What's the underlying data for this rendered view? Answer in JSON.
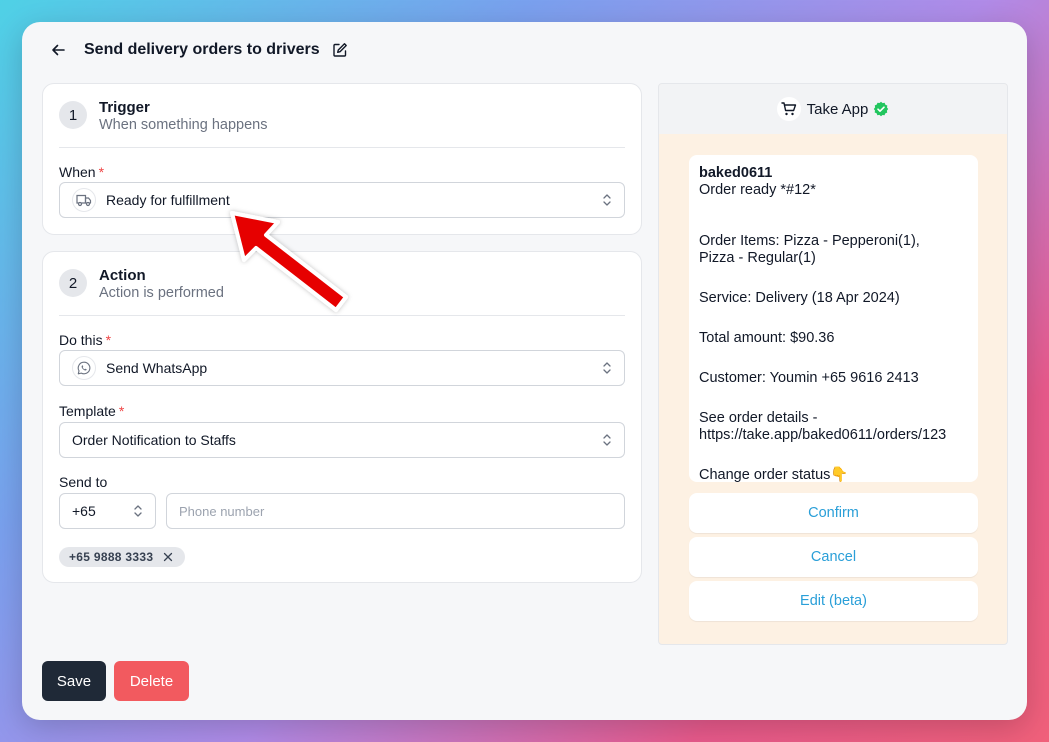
{
  "header": {
    "title": "Send delivery orders to drivers"
  },
  "trigger": {
    "number": "1",
    "title": "Trigger",
    "subtitle": "When something happens",
    "when_label": "When",
    "required_mark": "*",
    "when_value": "Ready for fulfillment",
    "when_icon": "truck-icon"
  },
  "action": {
    "number": "2",
    "title": "Action",
    "subtitle": "Action is performed",
    "do_label": "Do this",
    "required_mark": "*",
    "do_value": "Send WhatsApp",
    "do_icon": "whatsapp-icon",
    "template_label": "Template",
    "template_value": "Order Notification to Staffs",
    "send_to_label": "Send to",
    "country_code": "+65",
    "phone_placeholder": "Phone number",
    "recipients": [
      "+65 9888 3333"
    ]
  },
  "preview": {
    "brand": "Take App",
    "message": {
      "store": "baked0611",
      "lines": [
        "Order ready *#12*",
        "",
        "Order Items: Pizza - Pepperoni(1),\nPizza - Regular(1)",
        "",
        "Service: Delivery (18 Apr 2024)",
        "",
        "Total amount: $90.36",
        "",
        "Customer: Youmin +65 9616 2413",
        "",
        "See order details -\nhttps://take.app/baked0611/orders/123",
        "",
        "Change order status👇"
      ]
    },
    "quick_replies": [
      "Confirm",
      "Cancel",
      "Edit (beta)"
    ]
  },
  "footer": {
    "save": "Save",
    "delete": "Delete"
  },
  "colors": {
    "primary_dark": "#1f2937",
    "danger": "#f25a5f",
    "link": "#2a9fd8",
    "verified": "#22c55e",
    "required": "#ef4444",
    "annotation_arrow": "#e60000"
  }
}
